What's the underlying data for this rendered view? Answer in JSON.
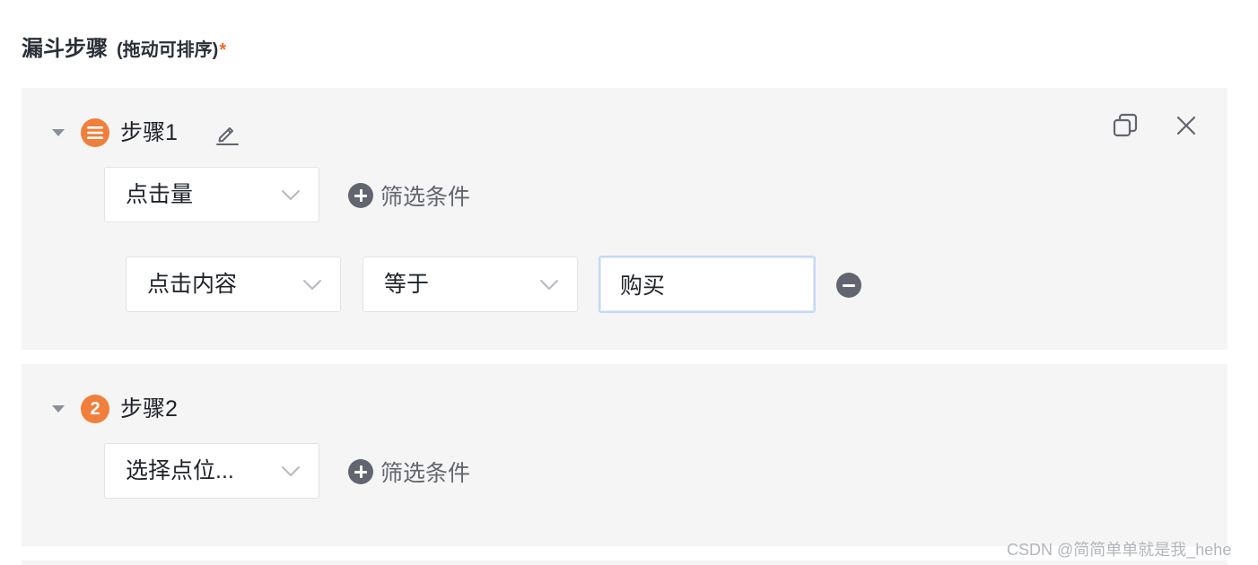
{
  "section": {
    "title": "漏斗步骤",
    "subtitle": "(拖动可排序)",
    "required_mark": "*"
  },
  "steps": [
    {
      "name": "步骤1",
      "badge": "menu-icon",
      "expanded": true,
      "metric": "点击量",
      "add_filter_label": "筛选条件",
      "filters": [
        {
          "field": "点击内容",
          "operator": "等于",
          "value": "购买"
        }
      ]
    },
    {
      "name": "步骤2",
      "badge": "2",
      "expanded": true,
      "metric": "选择点位...",
      "add_filter_label": "筛选条件",
      "filters": []
    }
  ],
  "watermark": "CSDN @简简单单就是我_hehe",
  "colors": {
    "accent_orange": "#f07f3c",
    "required_mark": "#f06a2a",
    "card_bg": "#f5f5f5",
    "icon_gray": "#62656f",
    "input_focus_border": "#c5d8f7"
  },
  "icons": [
    "caret-down-icon",
    "menu-icon",
    "edit-pencil-icon",
    "copy-icon",
    "close-icon",
    "chevron-down-icon",
    "plus-circle-icon",
    "minus-circle-icon"
  ]
}
